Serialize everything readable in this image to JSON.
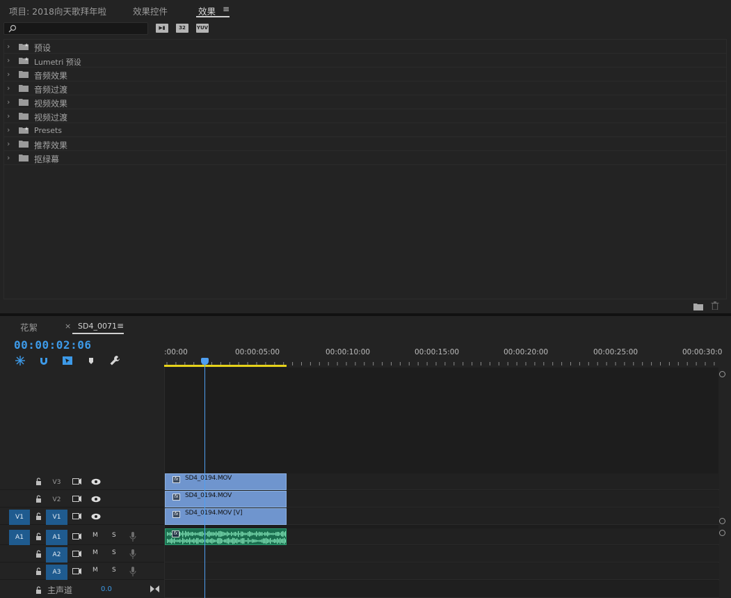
{
  "top_tabs": [
    {
      "label": "项目: 2018向天歌拜年啦",
      "active": false
    },
    {
      "label": "效果控件",
      "active": false
    },
    {
      "label": "效果",
      "active": true
    }
  ],
  "search": {
    "placeholder": "",
    "value": ""
  },
  "accelerator_icons": [
    "accelerated-effects-icon",
    "32-bit-color-icon",
    "yuv-effects-icon"
  ],
  "effect_folders": [
    {
      "label": "预设",
      "icon": "preset-folder-icon"
    },
    {
      "label": "Lumetri 预设",
      "icon": "preset-folder-icon"
    },
    {
      "label": "音频效果",
      "icon": "folder-icon"
    },
    {
      "label": "音频过渡",
      "icon": "folder-icon"
    },
    {
      "label": "视频效果",
      "icon": "folder-icon"
    },
    {
      "label": "视频过渡",
      "icon": "folder-icon"
    },
    {
      "label": "Presets",
      "icon": "preset-folder-icon"
    },
    {
      "label": "推荐效果",
      "icon": "folder-icon"
    },
    {
      "label": "抠绿幕",
      "icon": "folder-icon"
    }
  ],
  "timeline_tabs": [
    {
      "label": "花絮",
      "active": false
    },
    {
      "label": "SD4_0071",
      "active": true
    }
  ],
  "timecode": "00:00:02:06",
  "ruler_labels": [
    ":00:00",
    "00:00:05:00",
    "00:00:10:00",
    "00:00:15:00",
    "00:00:20:00",
    "00:00:25:00",
    "00:00:30:0"
  ],
  "video_tracks": [
    {
      "name": "V3",
      "source": "",
      "clip": "SD4_0194.MOV"
    },
    {
      "name": "V2",
      "source": "",
      "clip": "SD4_0194.MOV"
    },
    {
      "name": "V1",
      "source": "V1",
      "clip": "SD4_0194.MOV [V]"
    }
  ],
  "audio_tracks": [
    {
      "name": "A1",
      "source": "A1",
      "has_clip": true
    },
    {
      "name": "A2",
      "source": "",
      "has_clip": false
    },
    {
      "name": "A3",
      "source": "",
      "has_clip": false
    }
  ],
  "track_buttons": {
    "mute": "M",
    "solo": "S"
  },
  "master": {
    "label": "主声道",
    "value": "0.0"
  },
  "colors": {
    "accent": "#3d9ae8",
    "video_clip": "#6f95ce",
    "audio_clip": "#1a6e4f",
    "work_area": "#e6d21a",
    "track_target": "#1f5b8f"
  }
}
